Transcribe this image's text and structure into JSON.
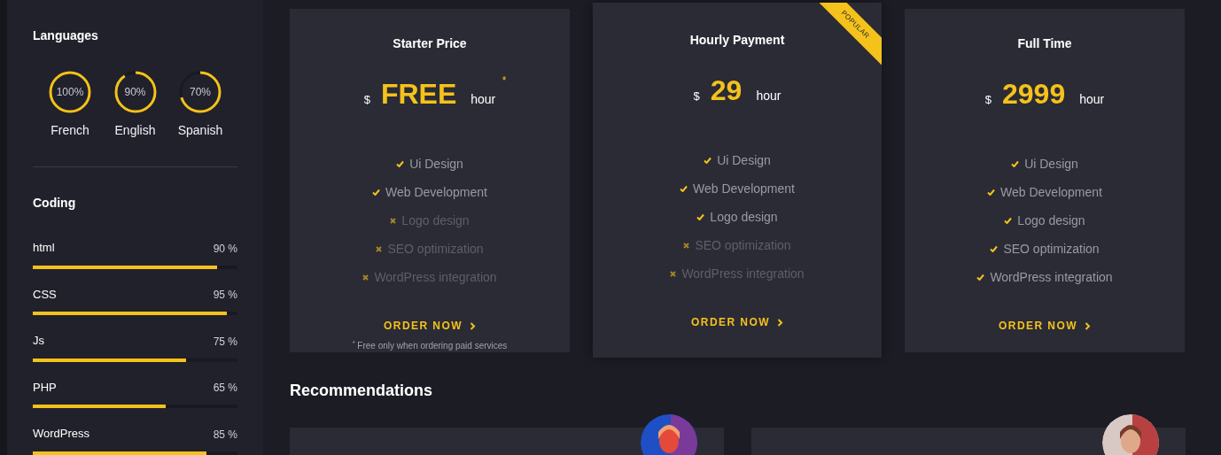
{
  "sidebar": {
    "languages": {
      "title": "Languages",
      "items": [
        {
          "name": "French",
          "reading": "100%"
        },
        {
          "name": "English",
          "reading": "90%"
        },
        {
          "name": "Spanish",
          "reading": "70%"
        }
      ]
    },
    "coding": {
      "title": "Coding",
      "items": [
        {
          "name": "html",
          "reading": "90 %",
          "level": 0.9
        },
        {
          "name": "CSS",
          "reading": "95 %",
          "level": 0.95
        },
        {
          "name": "Js",
          "reading": "75 %",
          "level": 0.75
        },
        {
          "name": "PHP",
          "reading": "65 %",
          "level": 0.65
        },
        {
          "name": "WordPress",
          "reading": "85 %",
          "level": 0.85
        }
      ]
    }
  },
  "plans": [
    {
      "title": "Starter Price",
      "currency": "$",
      "price": "FREE",
      "unit": "hour",
      "mark": "*",
      "popular": false,
      "features": [
        {
          "label": "Ui Design",
          "included": true
        },
        {
          "label": "Web Development",
          "included": true
        },
        {
          "label": "Logo design",
          "included": false
        },
        {
          "label": "SEO optimization",
          "included": false
        },
        {
          "label": "WordPress integration",
          "included": false
        }
      ],
      "button": "ORDER NOW",
      "note": "$^{*}$ Free only when ordering paid services"
    },
    {
      "title": "Hourly Payment",
      "currency": "$",
      "price": "29",
      "unit": "hour",
      "popular": true,
      "badge": "POPULAR",
      "features": [
        {
          "label": "Ui Design",
          "included": true
        },
        {
          "label": "Web Development",
          "included": true
        },
        {
          "label": "Logo design",
          "included": true
        },
        {
          "label": "SEO optimization",
          "included": false
        },
        {
          "label": "WordPress integration",
          "included": false
        }
      ],
      "button": "ORDER NOW"
    },
    {
      "title": "Full Time",
      "currency": "$",
      "price": "2999",
      "unit": "hour",
      "popular": false,
      "features": [
        {
          "label": "Ui Design",
          "included": true
        },
        {
          "label": "Web Development",
          "included": true
        },
        {
          "label": "Logo design",
          "included": true
        },
        {
          "label": "SEO optimization",
          "included": true
        },
        {
          "label": "WordPress integration",
          "included": true
        }
      ],
      "button": "ORDER NOW"
    }
  ],
  "recommendations": {
    "title": "Recommendations"
  }
}
